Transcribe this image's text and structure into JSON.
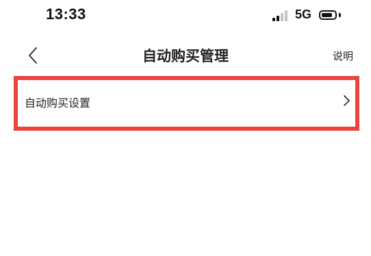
{
  "status_bar": {
    "time": "13:33",
    "network": "5G",
    "signal_bars_active": 2,
    "signal_bars_total": 4,
    "battery_level": 0.85
  },
  "nav": {
    "back_icon": "chevron-left-icon",
    "title": "自动购买管理",
    "help_label": "说明"
  },
  "settings_row": {
    "label": "自动购买设置",
    "chevron_icon": "chevron-right-icon"
  },
  "colors": {
    "highlight_border": "#e8463c",
    "signal_active": "#111111",
    "signal_inactive": "#c4c4c4",
    "background": "#ffffff"
  }
}
